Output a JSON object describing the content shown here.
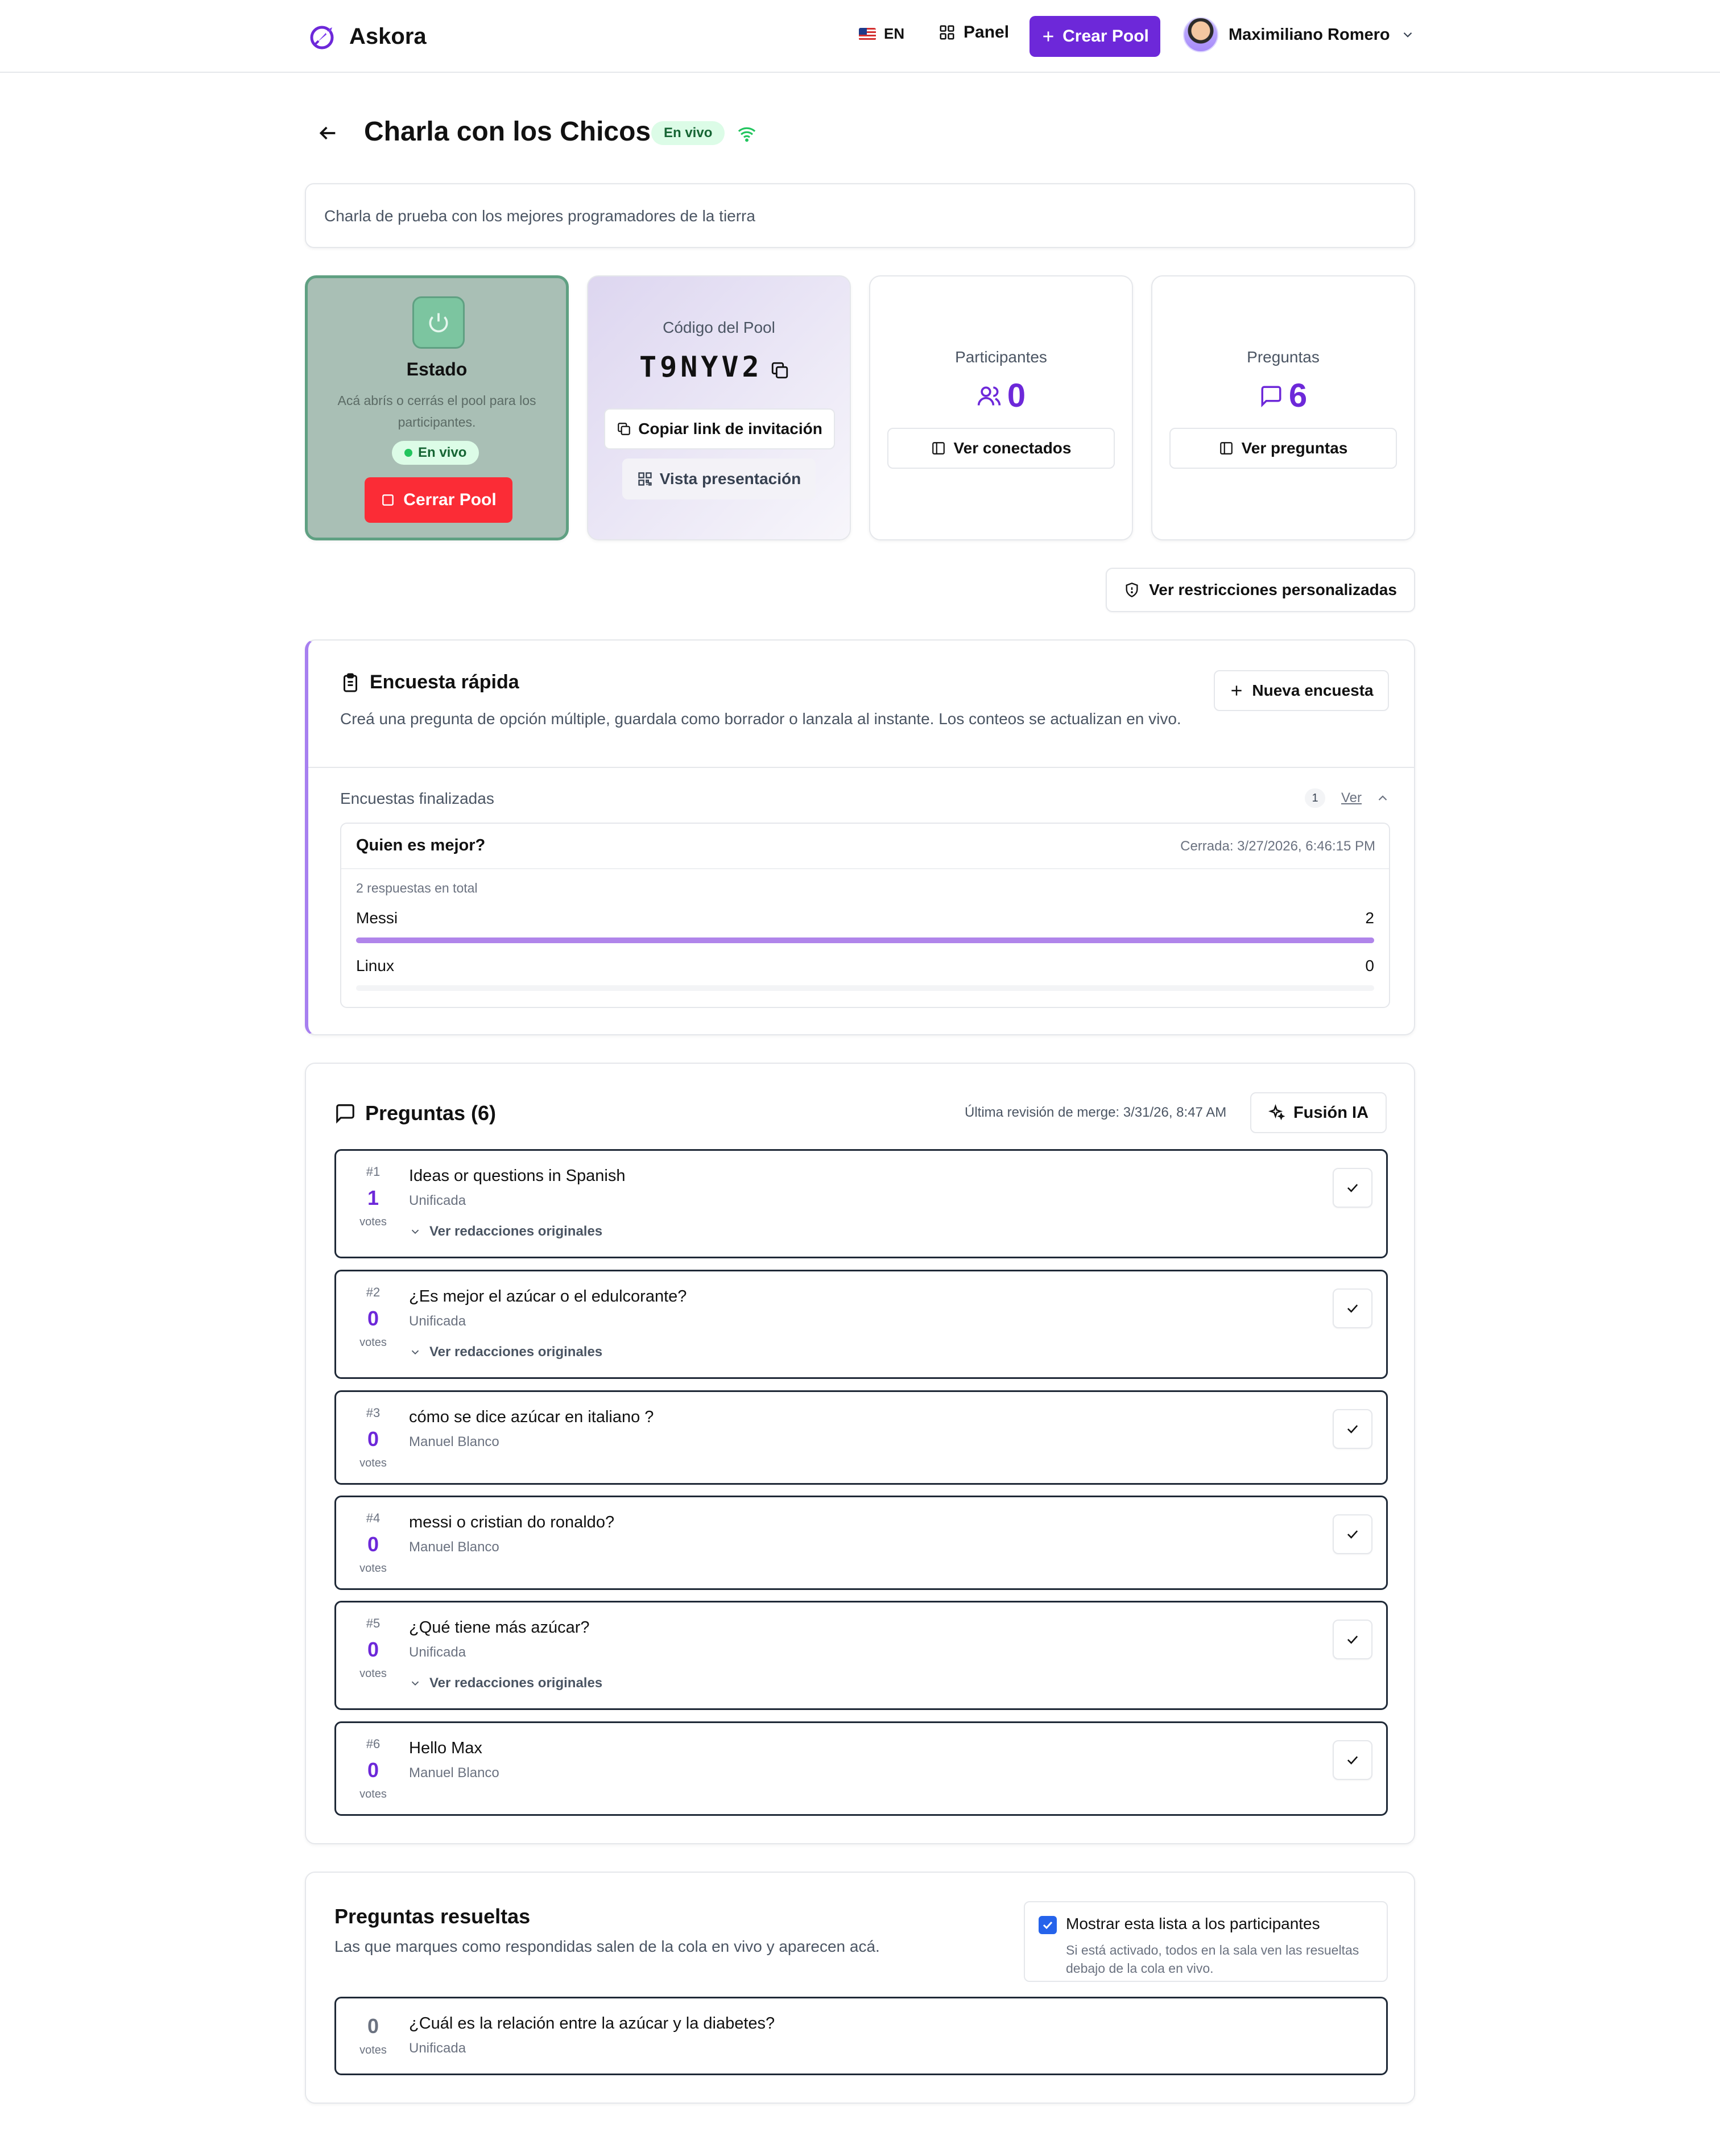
{
  "app": {
    "name": "Askora"
  },
  "header": {
    "lang": "EN",
    "panel": "Panel",
    "create_button": "Crear Pool",
    "user_name": "Maximiliano Romero"
  },
  "pool": {
    "title": "Charla con los Chicos",
    "live_badge": "En vivo",
    "description": "Charla de prueba con los mejores programadores de la tierra"
  },
  "estado": {
    "title": "Estado",
    "text": "Acá abrís o cerrás el pool para los participantes.",
    "badge": "En vivo",
    "close_button": "Cerrar Pool"
  },
  "codigo": {
    "label": "Código del Pool",
    "value": "T9NYV2",
    "copy_link_button": "Copiar link de invitación",
    "presentation_button": "Vista presentación"
  },
  "participantes": {
    "label": "Participantes",
    "value": "0",
    "button": "Ver conectados"
  },
  "preguntas_stat": {
    "label": "Preguntas",
    "value": "6",
    "button": "Ver preguntas"
  },
  "restrictions_button": "Ver restricciones personalizadas",
  "encuesta": {
    "title": "Encuesta rápida",
    "description": "Creá una pregunta de opción múltiple, guardala como borrador o lanzala al instante. Los conteos se actualizan en vivo.",
    "new_button": "Nueva encuesta",
    "finished_label": "Encuestas finalizadas",
    "finished_count": "1",
    "view_link": "Ver",
    "poll": {
      "question": "Quien es mejor?",
      "closed": "Cerrada: 3/27/2026, 6:46:15 PM",
      "total": "2 respuestas en total",
      "options": [
        {
          "label": "Messi",
          "count": "2",
          "fraction": 1.0
        },
        {
          "label": "Linux",
          "count": "0",
          "fraction": 0.0
        }
      ]
    }
  },
  "preguntas": {
    "title": "Preguntas (6)",
    "merge_review": "Última revisión de merge: 3/31/26, 8:47 AM",
    "fusion_button": "Fusión IA",
    "votes_label": "votes",
    "originals_label": "Ver redacciones originales",
    "items": [
      {
        "num": "#1",
        "votes": "1",
        "text": "Ideas or questions in Spanish",
        "author": "Unificada",
        "originals": true
      },
      {
        "num": "#2",
        "votes": "0",
        "text": "¿Es mejor el azúcar o el edulcorante?",
        "author": "Unificada",
        "originals": true
      },
      {
        "num": "#3",
        "votes": "0",
        "text": "cómo se dice azúcar en italiano ?",
        "author": "Manuel Blanco",
        "originals": false
      },
      {
        "num": "#4",
        "votes": "0",
        "text": "messi o cristian do ronaldo?",
        "author": "Manuel Blanco",
        "originals": false
      },
      {
        "num": "#5",
        "votes": "0",
        "text": "¿Qué tiene más azúcar?",
        "author": "Unificada",
        "originals": true
      },
      {
        "num": "#6",
        "votes": "0",
        "text": "Hello Max",
        "author": "Manuel Blanco",
        "originals": false
      }
    ]
  },
  "resueltas": {
    "title": "Preguntas resueltas",
    "description": "Las que marques como respondidas salen de la cola en vivo y aparecen acá.",
    "toggle_label": "Mostrar esta lista a los participantes",
    "toggle_sub": "Si está activado, todos en la sala ven las resueltas debajo de la cola en vivo.",
    "item": {
      "votes": "0",
      "votes_label": "votes",
      "text": "¿Cuál es la relación entre la azúcar y la diabetes?",
      "author": "Unificada"
    }
  }
}
